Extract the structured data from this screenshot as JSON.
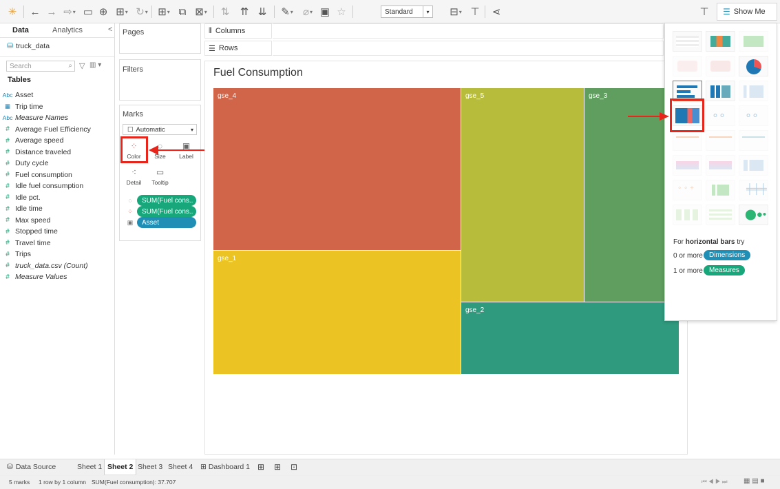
{
  "toolbar": {
    "fit_value": "Standard",
    "show_me_label": "Show Me"
  },
  "data_pane": {
    "tabs": [
      "Data",
      "Analytics"
    ],
    "source_name": "truck_data",
    "search_placeholder": "Search",
    "tables_heading": "Tables",
    "fields": [
      {
        "type": "Abc",
        "name": "Asset",
        "kind": "dim",
        "italic": false
      },
      {
        "type": "date",
        "name": "Trip time",
        "kind": "dim",
        "italic": false
      },
      {
        "type": "Abc",
        "name": "Measure Names",
        "kind": "dim",
        "italic": true
      },
      {
        "type": "#",
        "name": "Average Fuel Efficiency",
        "kind": "measure",
        "italic": false
      },
      {
        "type": "#",
        "name": "Average speed",
        "kind": "measure",
        "italic": false
      },
      {
        "type": "#",
        "name": "Distance traveled",
        "kind": "measure",
        "italic": false
      },
      {
        "type": "#",
        "name": "Duty cycle",
        "kind": "measure",
        "italic": false
      },
      {
        "type": "#",
        "name": "Fuel consumption",
        "kind": "measure",
        "italic": false
      },
      {
        "type": "#",
        "name": "Idle fuel consumption",
        "kind": "measure",
        "italic": false
      },
      {
        "type": "#",
        "name": "Idle pct.",
        "kind": "measure",
        "italic": false
      },
      {
        "type": "#",
        "name": "Idle time",
        "kind": "measure",
        "italic": false
      },
      {
        "type": "#",
        "name": "Max speed",
        "kind": "measure",
        "italic": false
      },
      {
        "type": "#",
        "name": "Stopped time",
        "kind": "measure",
        "italic": false
      },
      {
        "type": "#",
        "name": "Travel time",
        "kind": "measure",
        "italic": false
      },
      {
        "type": "#",
        "name": "Trips",
        "kind": "measure",
        "italic": false
      },
      {
        "type": "#",
        "name": "truck_data.csv (Count)",
        "kind": "measure",
        "italic": true
      },
      {
        "type": "#",
        "name": "Measure Values",
        "kind": "measure",
        "italic": true
      }
    ]
  },
  "shelves": {
    "pages": "Pages",
    "filters": "Filters",
    "marks": "Marks",
    "mark_type": "Automatic",
    "columns": "Columns",
    "rows": "Rows",
    "mark_buttons": {
      "color": "Color",
      "size": "Size",
      "label": "Label",
      "detail": "Detail",
      "tooltip": "Tooltip"
    },
    "pills": [
      {
        "text": "SUM(Fuel cons..",
        "color": "green"
      },
      {
        "text": "SUM(Fuel cons..",
        "color": "green"
      },
      {
        "text": "Asset",
        "color": "blue"
      }
    ]
  },
  "viz": {
    "title": "Fuel Consumption"
  },
  "chart_data": {
    "type": "treemap",
    "title": "Fuel Consumption",
    "tiles": [
      {
        "label": "gse_4",
        "color": "#d0654a"
      },
      {
        "label": "gse_1",
        "color": "#ebc423"
      },
      {
        "label": "gse_5",
        "color": "#b7bc3b"
      },
      {
        "label": "gse_3",
        "color": "#5f9e5e"
      },
      {
        "label": "gse_2",
        "color": "#2f9a7e"
      }
    ]
  },
  "show_me": {
    "hint_prefix": "For ",
    "hint_bold": "horizontal bars",
    "hint_suffix": " try",
    "dimensions_prefix": "0 or more",
    "dimensions_label": "Dimensions",
    "measures_prefix": "1 or more",
    "measures_label": "Measures"
  },
  "sheet_tabs": {
    "data_source": "Data Source",
    "sheets": [
      "Sheet 1",
      "Sheet 2",
      "Sheet 3",
      "Sheet 4",
      "Dashboard 1"
    ],
    "active": "Sheet 2"
  },
  "status": {
    "marks": "5 marks",
    "rows_cols": "1 row by 1 column",
    "sum": "SUM(Fuel consumption): 37.707"
  },
  "colors": {
    "highlight_red": "#e8251a",
    "pill_green": "#17a77b",
    "pill_blue": "#1f8fb6"
  }
}
